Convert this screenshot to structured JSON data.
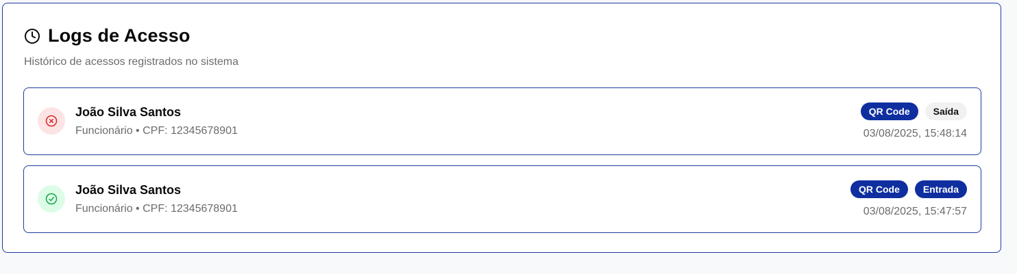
{
  "header": {
    "title": "Logs de Acesso",
    "subtitle": "Histórico de acessos registrados no sistema",
    "icon": "clock-icon"
  },
  "logs": [
    {
      "name": "João Silva Santos",
      "details": "Funcionário • CPF: 12345678901",
      "method": "QR Code",
      "direction": "Saída",
      "timestamp": "03/08/2025, 15:48:14",
      "status_icon": "x-circle-icon",
      "status_color": "#dc2626"
    },
    {
      "name": "João Silva Santos",
      "details": "Funcionário • CPF: 12345678901",
      "method": "QR Code",
      "direction": "Entrada",
      "timestamp": "03/08/2025, 15:47:57",
      "status_icon": "check-circle-icon",
      "status_color": "#16a34a"
    }
  ],
  "colors": {
    "accent": "#1f3a9e",
    "badge_primary": "#0f2fa0",
    "badge_secondary": "#f1f1f1"
  }
}
